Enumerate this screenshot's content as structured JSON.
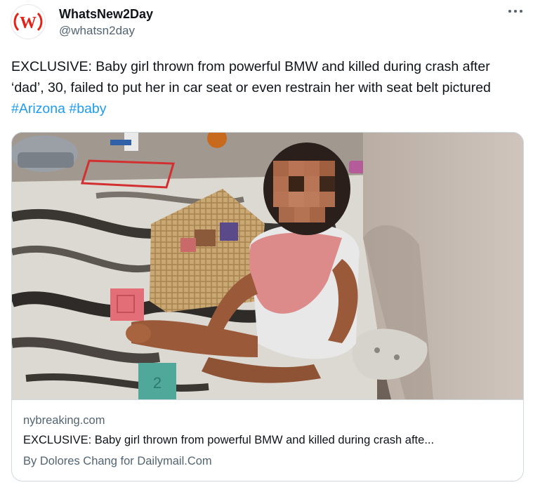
{
  "author": {
    "name": "WhatsNew2Day",
    "handle": "@whatsn2day",
    "avatar_letter": "W",
    "avatar_color": "#e2231a"
  },
  "more_icon": "more-horizontal-icon",
  "tweet": {
    "text": "EXCLUSIVE: Baby girl thrown from powerful BMW and killed during crash after ‘dad’, 30, failed to put her in car seat or even restrain her with seat belt pictured ",
    "hashtags": [
      "#Arizona",
      "#baby"
    ]
  },
  "card": {
    "domain": "nybreaking.com",
    "title": "EXCLUSIVE: Baby girl thrown from powerful BMW and killed during crash afte...",
    "byline": "By Dolores Chang for Dailymail.Com",
    "cube_number": "2"
  },
  "colors": {
    "hashtag": "#1d9bf0",
    "secondary_text": "#536471",
    "border": "#cfd9de"
  }
}
